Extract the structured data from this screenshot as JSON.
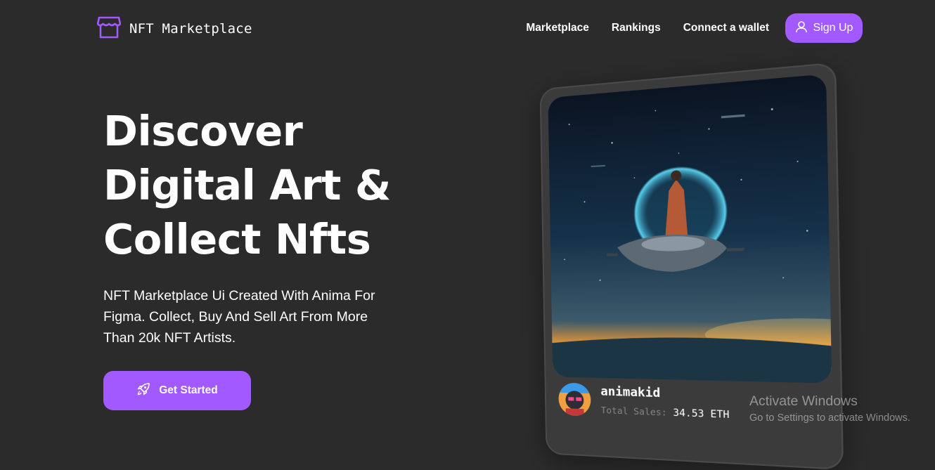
{
  "header": {
    "logo_text": "NFT Marketplace",
    "logo_icon": "storefront-icon",
    "nav": [
      {
        "label": "Marketplace"
      },
      {
        "label": "Rankings"
      },
      {
        "label": "Connect a wallet"
      }
    ],
    "signup_label": "Sign Up",
    "signup_icon": "user-icon"
  },
  "hero": {
    "title_lines": [
      "Discover",
      "Digital Art &",
      "Collect Nfts"
    ],
    "subtitle": "NFT Marketplace Ui Created With Anima For Figma. Collect, Buy And Sell Art From More Than 20k NFT Artists.",
    "cta_label": "Get Started",
    "cta_icon": "rocket-icon"
  },
  "card": {
    "artist": "animakid",
    "sales_label": "Total Sales:",
    "sales_value": "34.53 ETH"
  },
  "watermark": {
    "title": "Activate Windows",
    "subtitle": "Go to Settings to activate Windows."
  },
  "colors": {
    "background": "#2b2b2b",
    "accent": "#a259ff",
    "card": "#3b3b3b",
    "muted_text": "#858584"
  }
}
